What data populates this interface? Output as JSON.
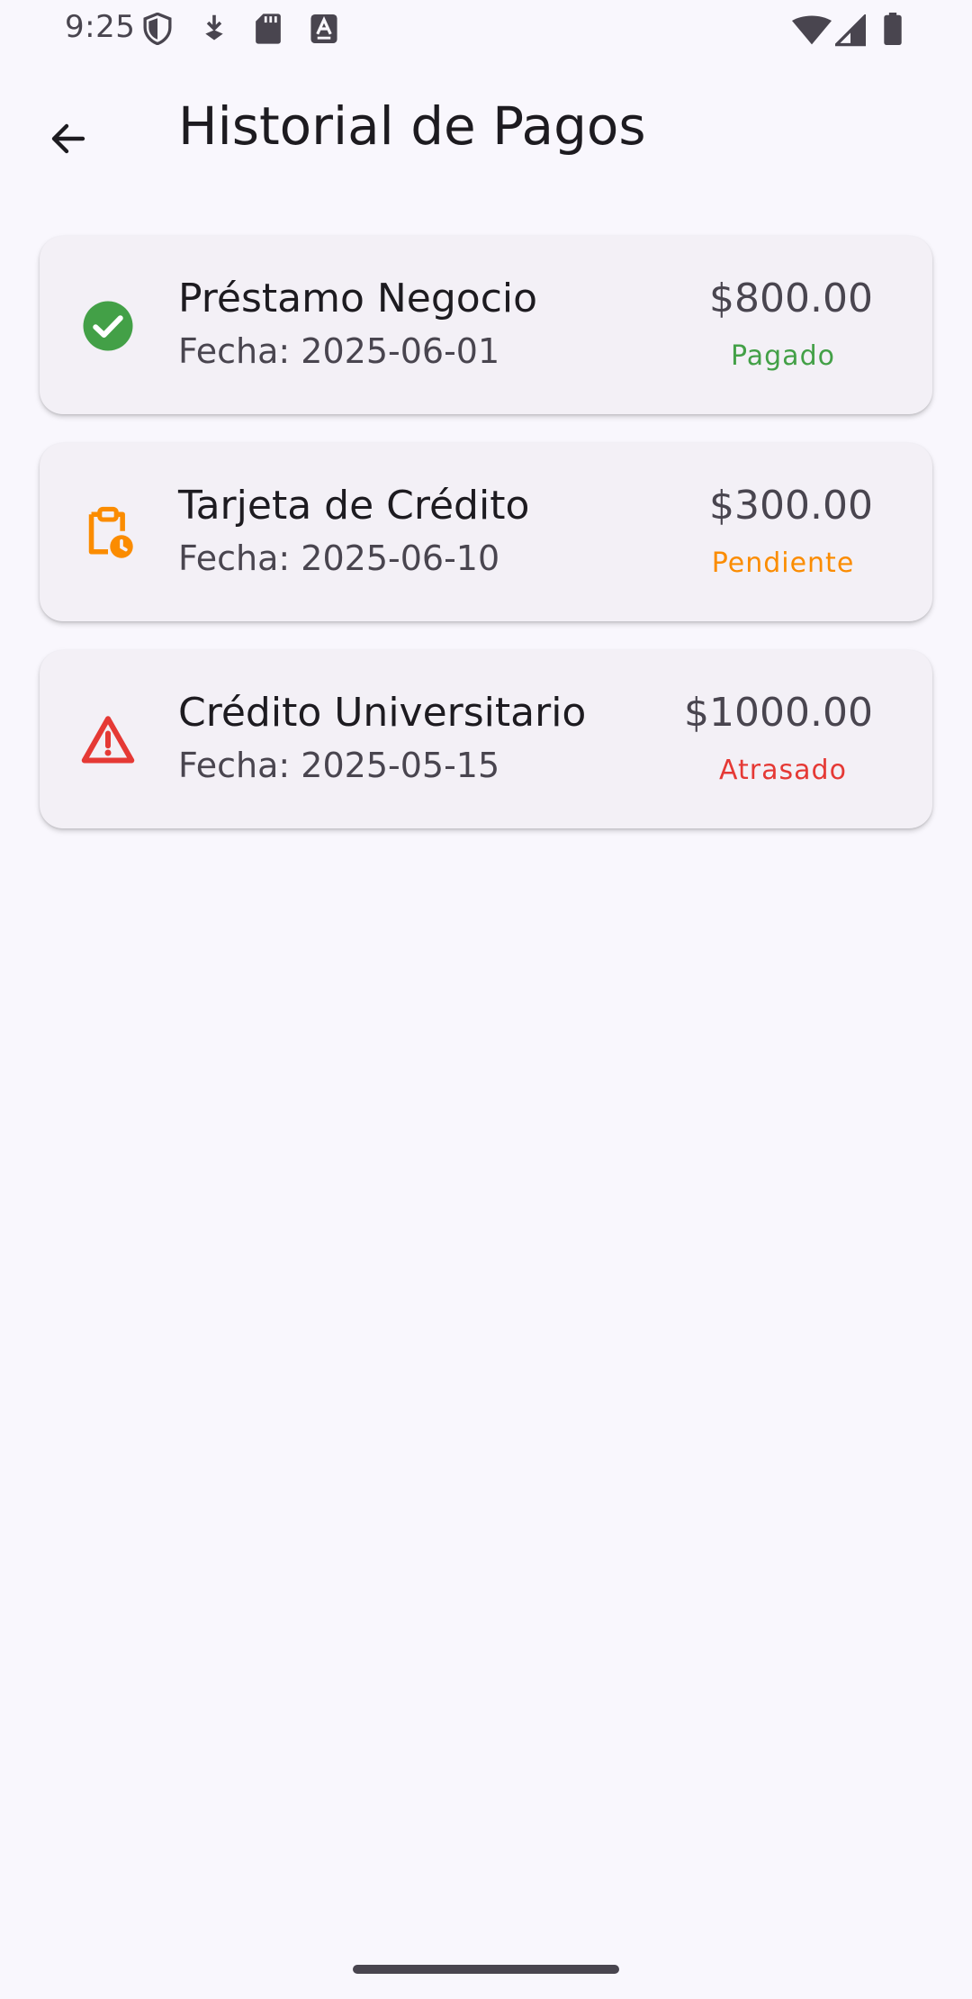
{
  "status_bar": {
    "time": "9:25",
    "icons": [
      "shield-icon",
      "download-icon",
      "sd-card-icon",
      "a-box-icon",
      "wifi-icon",
      "signal-icon",
      "battery-icon"
    ]
  },
  "app_bar": {
    "title": "Historial de Pagos",
    "back_icon": "arrow-back-icon"
  },
  "payments": [
    {
      "title": "Préstamo Negocio",
      "date": "Fecha: 2025-06-01",
      "amount": "$800.00",
      "status": "Pagado",
      "status_color": "#43a047",
      "icon": "check-circle-icon"
    },
    {
      "title": "Tarjeta de Crédito",
      "date": "Fecha: 2025-06-10",
      "amount": "$300.00",
      "status": "Pendiente",
      "status_color": "#fb8c00",
      "icon": "pending-clipboard-icon"
    },
    {
      "title": "Crédito Universitario",
      "date": "Fecha: 2025-05-15",
      "amount": "$1000.00",
      "status": "Atrasado",
      "status_color": "#e53935",
      "icon": "warning-icon"
    }
  ]
}
